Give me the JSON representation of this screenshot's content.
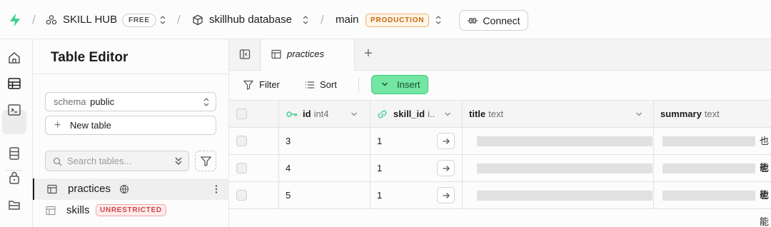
{
  "colors": {
    "brand": "#3ecf8e",
    "insert_bg": "#72e6a2",
    "production_text": "#c46a12",
    "unrestricted_text": "#d04545"
  },
  "topbar": {
    "org_name": "SKILL HUB",
    "org_plan": "FREE",
    "project_name": "skillhub database",
    "branch_name": "main",
    "branch_env": "PRODUCTION",
    "connect_label": "Connect"
  },
  "rail": {
    "icons": [
      "home-icon",
      "table-editor-icon",
      "sql-editor-icon",
      "database-icon",
      "auth-lock-icon",
      "storage-icon"
    ]
  },
  "panel": {
    "title": "Table Editor",
    "schema_label": "schema",
    "schema_value": "public",
    "new_table_label": "New table",
    "search_placeholder": "Search tables...",
    "tables": [
      {
        "name": "practices",
        "badge": ""
      },
      {
        "name": "skills",
        "badge": "UNRESTRICTED"
      }
    ]
  },
  "tabs": {
    "active_tab": "practices"
  },
  "toolbar": {
    "filter_label": "Filter",
    "sort_label": "Sort",
    "insert_label": "Insert"
  },
  "grid": {
    "columns": [
      {
        "name": "id",
        "type": "int4"
      },
      {
        "name": "skill_id",
        "type": "i.."
      },
      {
        "name": "title",
        "type": "text"
      },
      {
        "name": "summary",
        "type": "text"
      }
    ],
    "rows": [
      {
        "id": "3",
        "skill_id": "1",
        "summary_tail": "也能"
      },
      {
        "id": "4",
        "skill_id": "1",
        "summary_tail": "也能"
      },
      {
        "id": "5",
        "skill_id": "1",
        "summary_tail": "也能"
      }
    ]
  }
}
